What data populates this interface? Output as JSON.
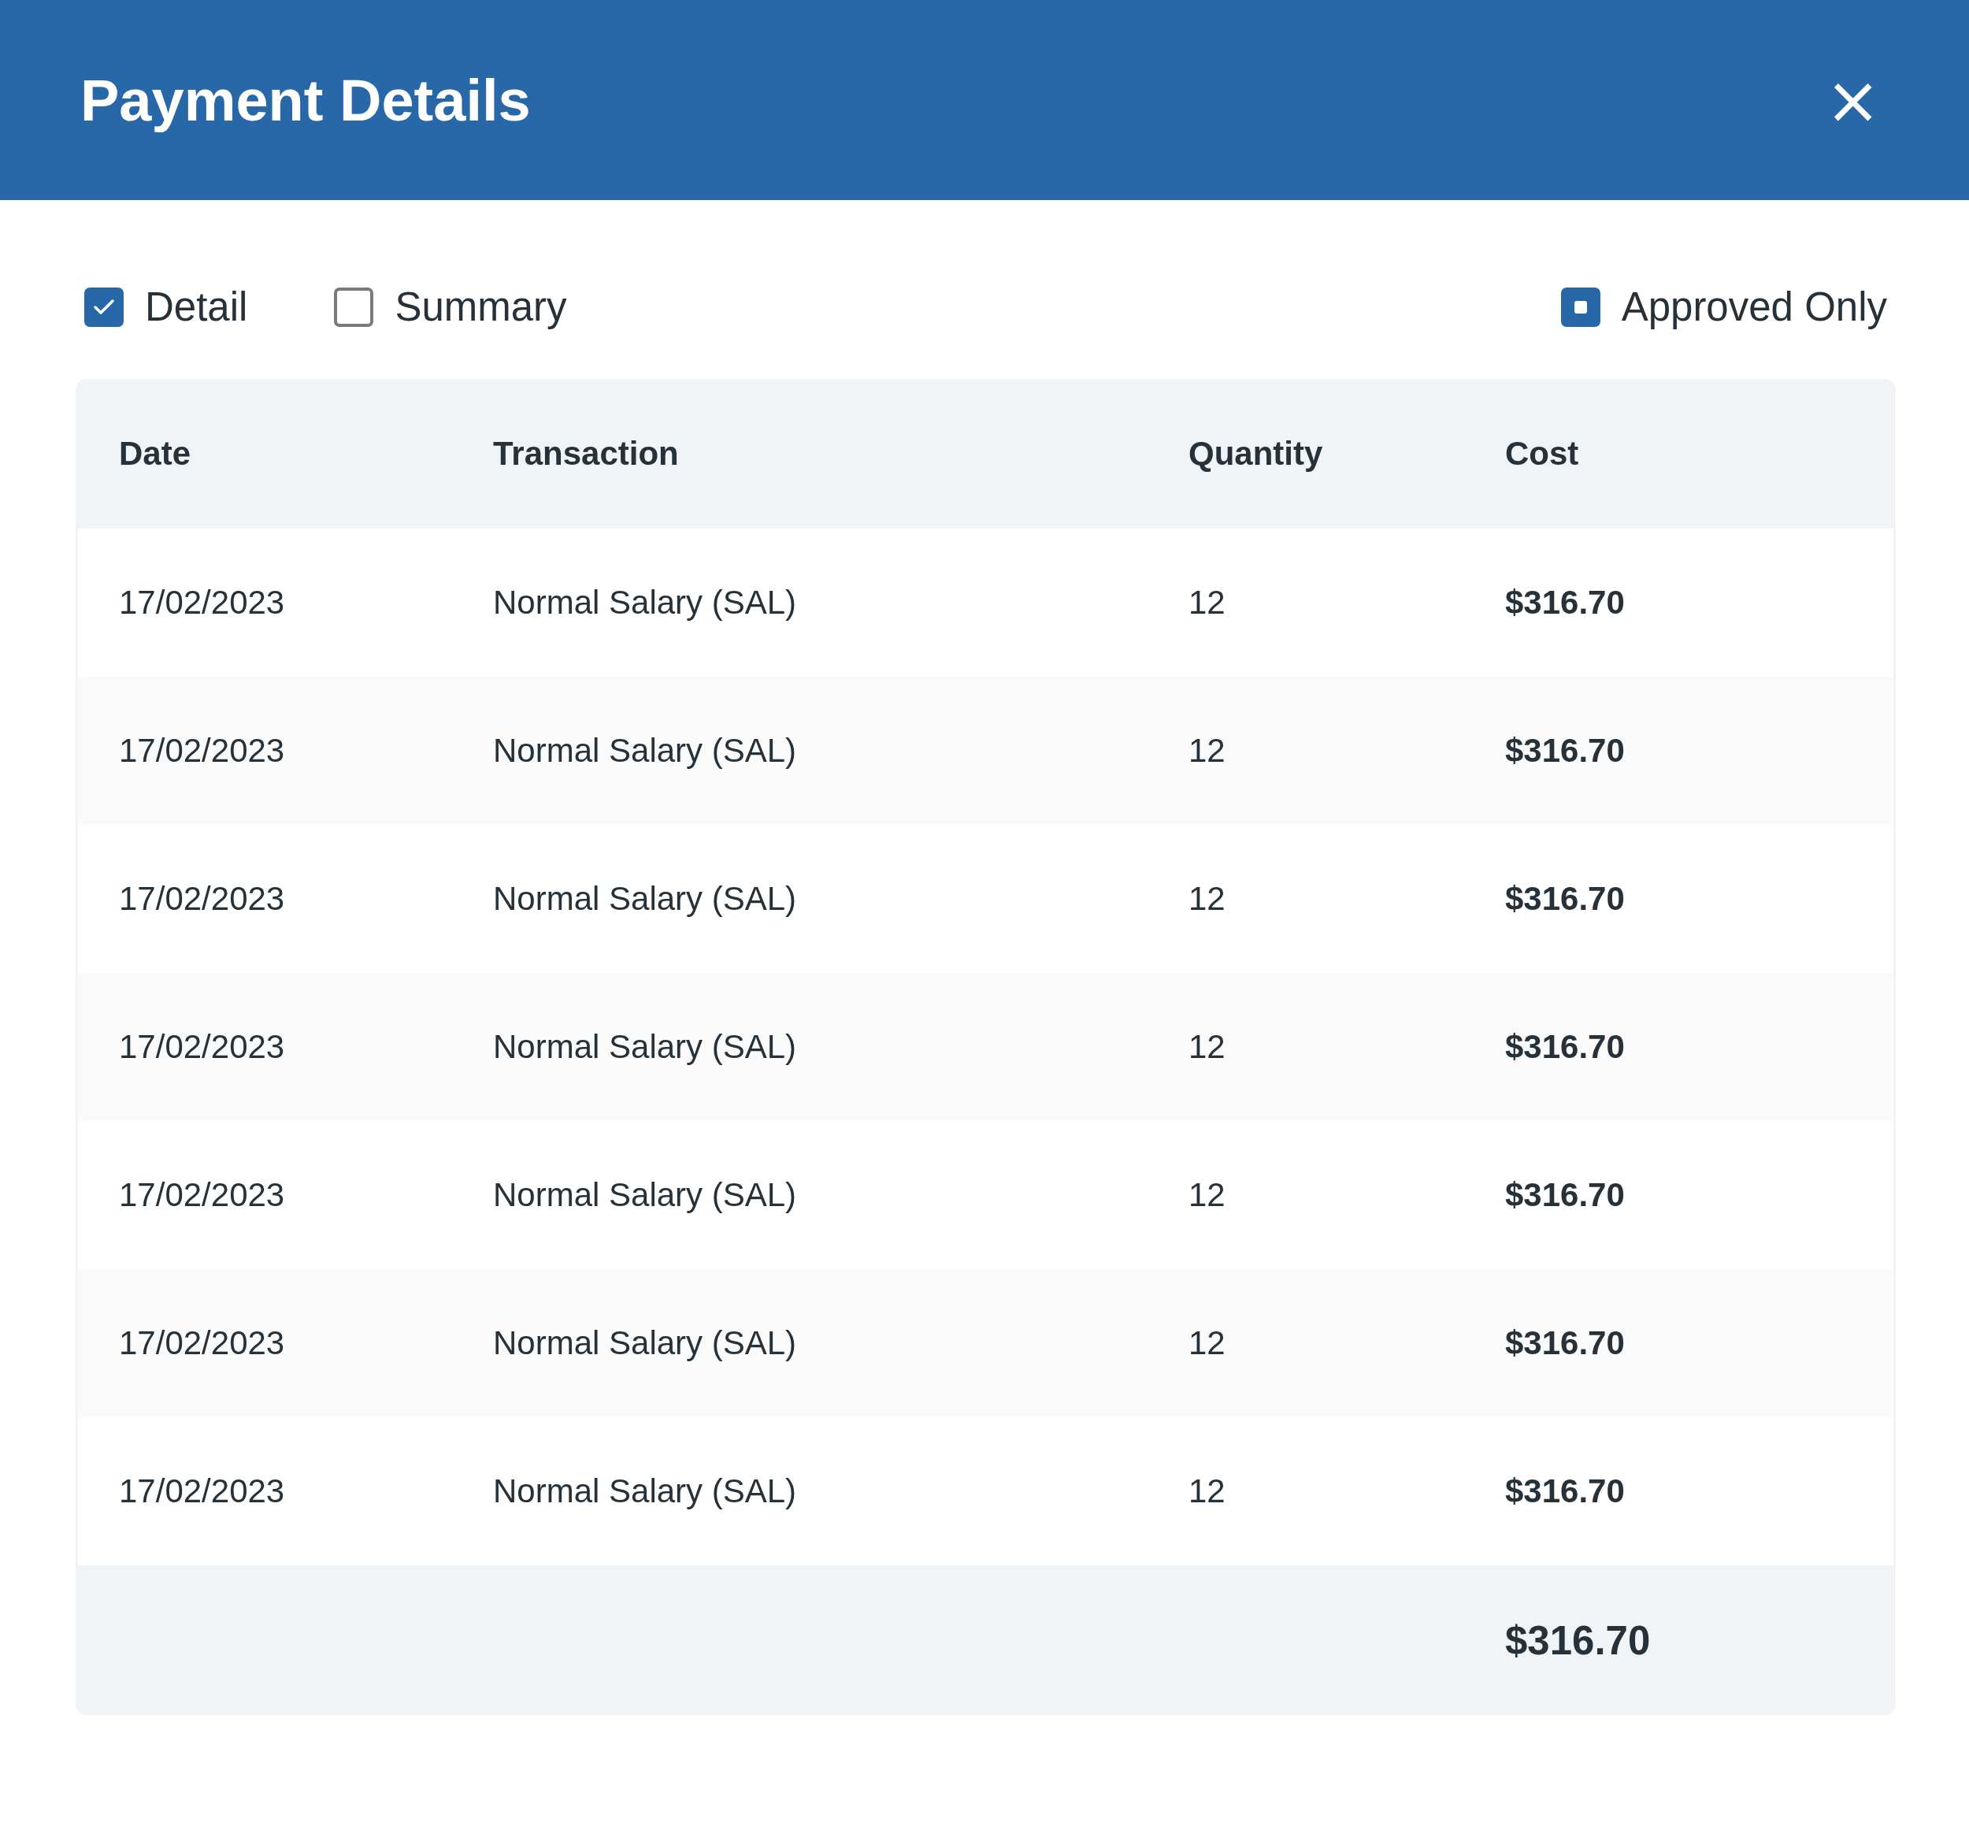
{
  "window": {
    "title": "Payment Details",
    "close": "×"
  },
  "filters": [
    {
      "label": "Detail",
      "kind": "check",
      "checked": true
    },
    {
      "label": "Summary",
      "kind": "check",
      "checked": false
    }
  ],
  "approved_only": {
    "label": "Approved Only",
    "kind": "square",
    "checked": true
  },
  "table": {
    "columns": [
      "Date",
      "Transaction",
      "Quantity",
      "Cost"
    ],
    "rows": [
      [
        "17/02/2023",
        "Normal Salary (SAL)",
        "12",
        "$316.70"
      ],
      [
        "17/02/2023",
        "Normal Salary (SAL)",
        "12",
        "$316.70"
      ],
      [
        "17/02/2023",
        "Normal Salary (SAL)",
        "12",
        "$316.70"
      ],
      [
        "17/02/2023",
        "Normal Salary (SAL)",
        "12",
        "$316.70"
      ],
      [
        "17/02/2023",
        "Normal Salary (SAL)",
        "12",
        "$316.70"
      ],
      [
        "17/02/2023",
        "Normal Salary (SAL)",
        "12",
        "$316.70"
      ],
      [
        "17/02/2023",
        "Normal Salary (SAL)",
        "12",
        "$316.70"
      ]
    ],
    "total": "$316.70"
  }
}
